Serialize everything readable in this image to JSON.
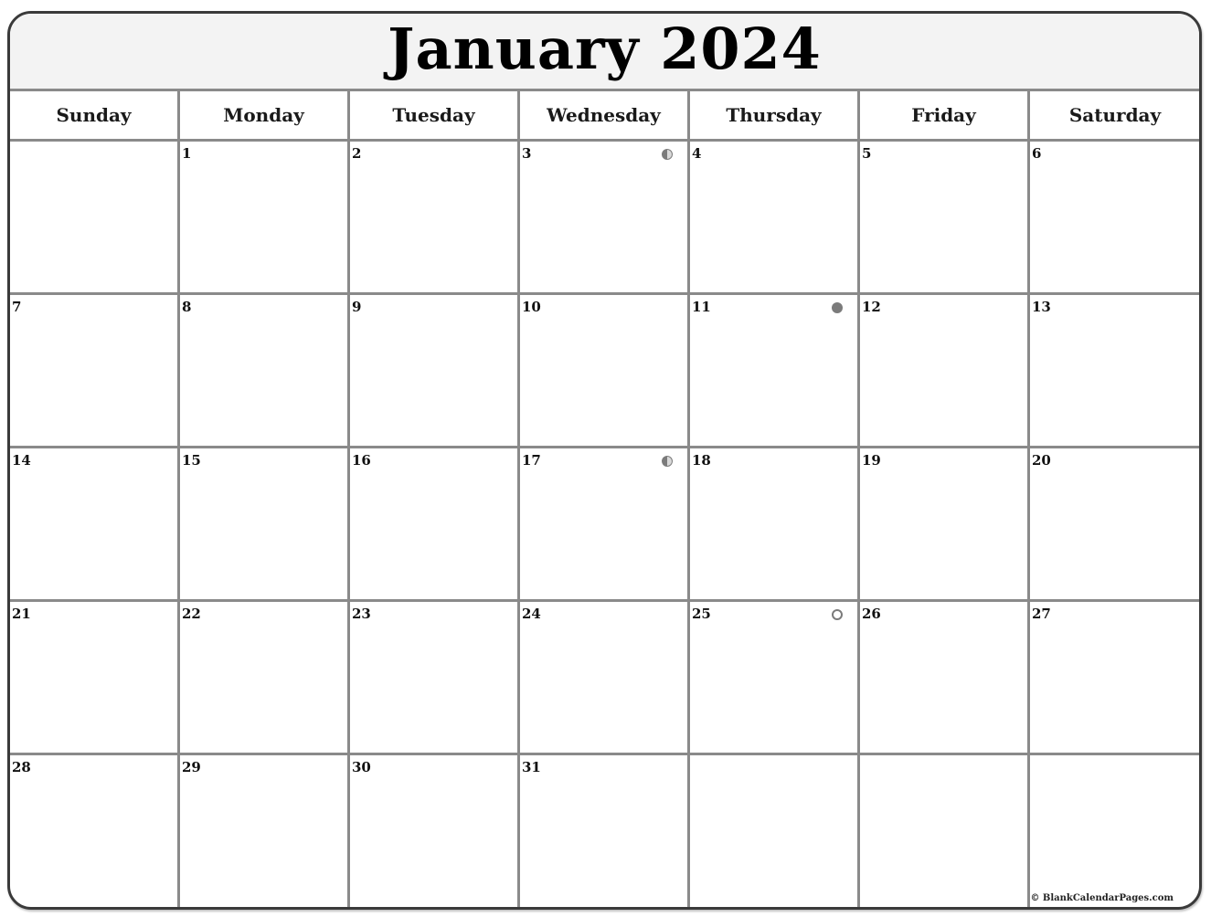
{
  "calendar": {
    "title": "January 2024",
    "weekdays": [
      "Sunday",
      "Monday",
      "Tuesday",
      "Wednesday",
      "Thursday",
      "Friday",
      "Saturday"
    ],
    "weeks": [
      [
        "",
        "1",
        "2",
        "3",
        "4",
        "5",
        "6"
      ],
      [
        "7",
        "8",
        "9",
        "10",
        "11",
        "12",
        "13"
      ],
      [
        "14",
        "15",
        "16",
        "17",
        "18",
        "19",
        "20"
      ],
      [
        "21",
        "22",
        "23",
        "24",
        "25",
        "26",
        "27"
      ],
      [
        "28",
        "29",
        "30",
        "31",
        "",
        "",
        ""
      ]
    ],
    "moon_phases": [
      {
        "day": "3",
        "phase": "last-quarter",
        "icon": "last-quarter-moon-icon"
      },
      {
        "day": "11",
        "phase": "new",
        "icon": "new-moon-icon"
      },
      {
        "day": "17",
        "phase": "first-quarter",
        "icon": "first-quarter-moon-icon"
      },
      {
        "day": "25",
        "phase": "full",
        "icon": "full-moon-icon"
      }
    ]
  },
  "footer": {
    "copyright": "© BlankCalendarPages.com"
  },
  "colors": {
    "frame_border": "#3a3a3a",
    "grid_lines": "#8a8a8a",
    "title_background": "#f3f3f3",
    "moon": "#7b7b7b"
  }
}
